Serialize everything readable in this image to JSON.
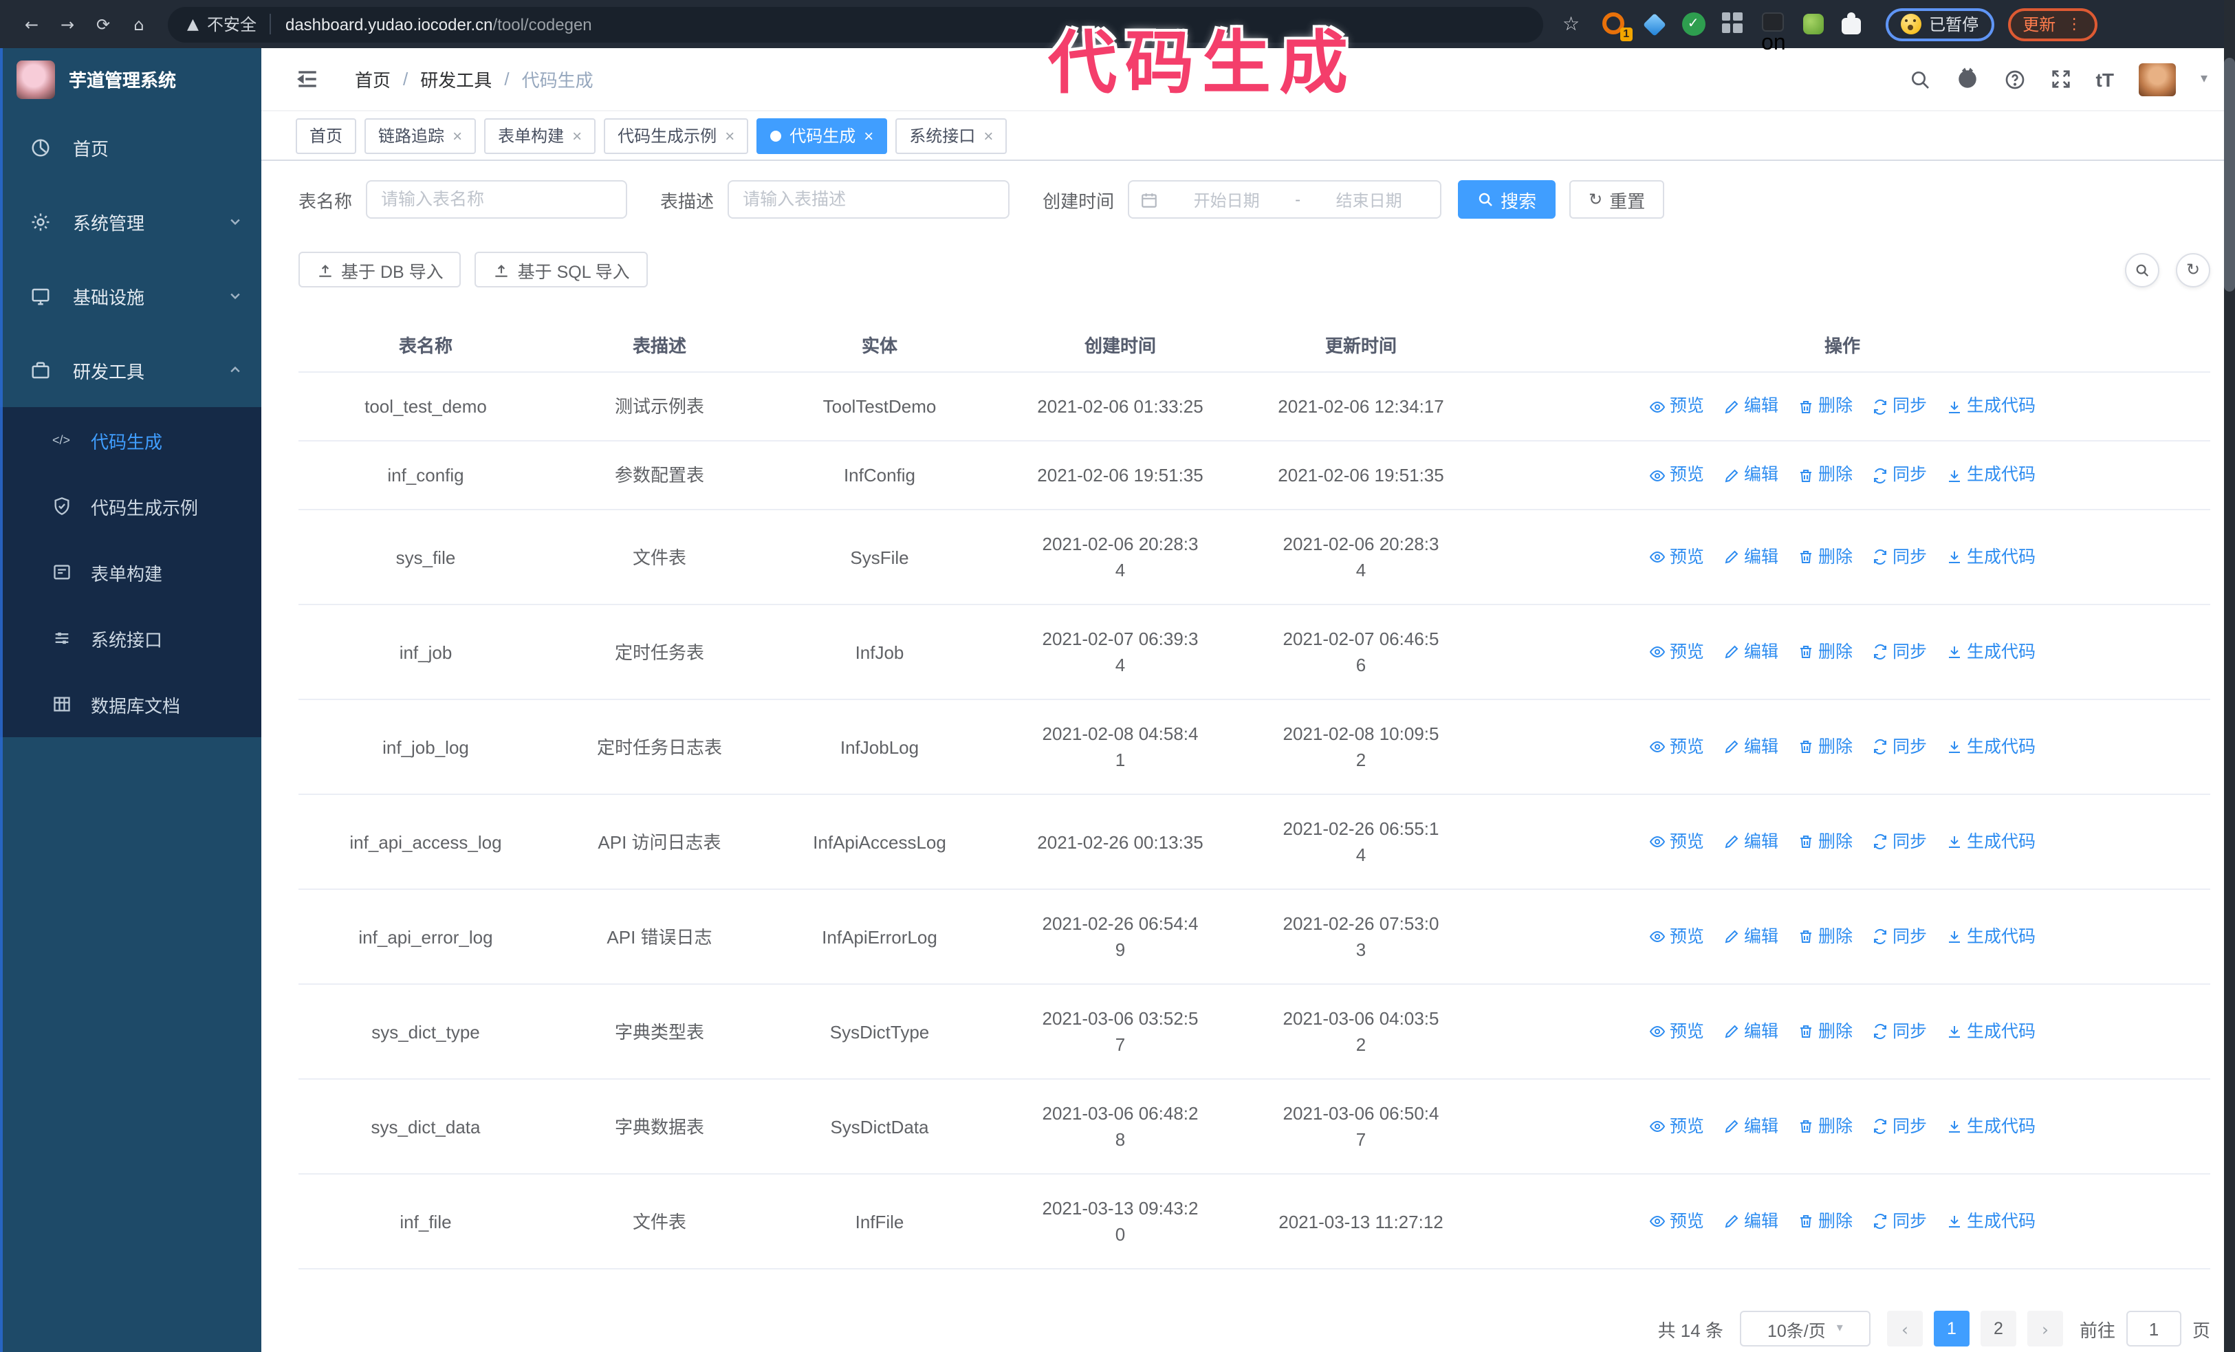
{
  "browser": {
    "security_label": "不安全",
    "url_host": "dashboard.yudao.iocoder.cn",
    "url_path": "/tool/codegen",
    "ext_badge": "1",
    "ext_on_badge": "on",
    "paused_pill": "已暂停",
    "update_button": "更新"
  },
  "annotation": {
    "text": "代码生成",
    "color": "#f43e6b"
  },
  "sidebar": {
    "title": "芋道管理系统",
    "items": [
      {
        "label": "首页"
      },
      {
        "label": "系统管理"
      },
      {
        "label": "基础设施"
      },
      {
        "label": "研发工具"
      }
    ],
    "subitems": [
      {
        "label": "代码生成",
        "active": true
      },
      {
        "label": "代码生成示例"
      },
      {
        "label": "表单构建"
      },
      {
        "label": "系统接口"
      },
      {
        "label": "数据库文档"
      }
    ]
  },
  "navbar": {
    "breadcrumb": [
      "首页",
      "研发工具",
      "代码生成"
    ],
    "separator": "/"
  },
  "tabs": [
    {
      "label": "首页"
    },
    {
      "label": "链路追踪"
    },
    {
      "label": "表单构建"
    },
    {
      "label": "代码生成示例"
    },
    {
      "label": "代码生成"
    },
    {
      "label": "系统接口"
    }
  ],
  "filters": {
    "name_label": "表名称",
    "name_placeholder": "请输入表名称",
    "desc_label": "表描述",
    "desc_placeholder": "请输入表描述",
    "time_label": "创建时间",
    "start_placeholder": "开始日期",
    "range_separator": "-",
    "end_placeholder": "结束日期",
    "search_button": "搜索",
    "reset_button": "重置"
  },
  "toolbar": {
    "import_db": "基于 DB 导入",
    "import_sql": "基于 SQL 导入"
  },
  "table": {
    "columns": [
      "表名称",
      "表描述",
      "实体",
      "创建时间",
      "更新时间",
      "操作"
    ],
    "actions": [
      {
        "key": "preview",
        "label": "预览"
      },
      {
        "key": "edit",
        "label": "编辑"
      },
      {
        "key": "delete",
        "label": "删除"
      },
      {
        "key": "sync",
        "label": "同步"
      },
      {
        "key": "generate",
        "label": "生成代码"
      }
    ],
    "rows": [
      {
        "name": "tool_test_demo",
        "desc": "测试示例表",
        "entity": "ToolTestDemo",
        "created": "2021-02-06 01:33:25",
        "updated": "2021-02-06 12:34:17"
      },
      {
        "name": "inf_config",
        "desc": "参数配置表",
        "entity": "InfConfig",
        "created": "2021-02-06 19:51:35",
        "updated": "2021-02-06 19:51:35"
      },
      {
        "name": "sys_file",
        "desc": "文件表",
        "entity": "SysFile",
        "created": "2021-02-06 20:28:3\n4",
        "updated": "2021-02-06 20:28:3\n4"
      },
      {
        "name": "inf_job",
        "desc": "定时任务表",
        "entity": "InfJob",
        "created": "2021-02-07 06:39:3\n4",
        "updated": "2021-02-07 06:46:5\n6"
      },
      {
        "name": "inf_job_log",
        "desc": "定时任务日志表",
        "entity": "InfJobLog",
        "created": "2021-02-08 04:58:4\n1",
        "updated": "2021-02-08 10:09:5\n2"
      },
      {
        "name": "inf_api_access_log",
        "desc": "API 访问日志表",
        "entity": "InfApiAccessLog",
        "created": "2021-02-26 00:13:35",
        "updated": "2021-02-26 06:55:1\n4"
      },
      {
        "name": "inf_api_error_log",
        "desc": "API 错误日志",
        "entity": "InfApiErrorLog",
        "created": "2021-02-26 06:54:4\n9",
        "updated": "2021-02-26 07:53:0\n3"
      },
      {
        "name": "sys_dict_type",
        "desc": "字典类型表",
        "entity": "SysDictType",
        "created": "2021-03-06 03:52:5\n7",
        "updated": "2021-03-06 04:03:5\n2"
      },
      {
        "name": "sys_dict_data",
        "desc": "字典数据表",
        "entity": "SysDictData",
        "created": "2021-03-06 06:48:2\n8",
        "updated": "2021-03-06 06:50:4\n7"
      },
      {
        "name": "inf_file",
        "desc": "文件表",
        "entity": "InfFile",
        "created": "2021-03-13 09:43:2\n0",
        "updated": "2021-03-13 11:27:12"
      }
    ]
  },
  "pagination": {
    "total": "共 14 条",
    "page_size": "10条/页",
    "prev": "‹",
    "next": "›",
    "pages": [
      "1",
      "2"
    ],
    "active_page": "1",
    "goto_label": "前往",
    "goto_value": "1",
    "goto_suffix": "页"
  }
}
